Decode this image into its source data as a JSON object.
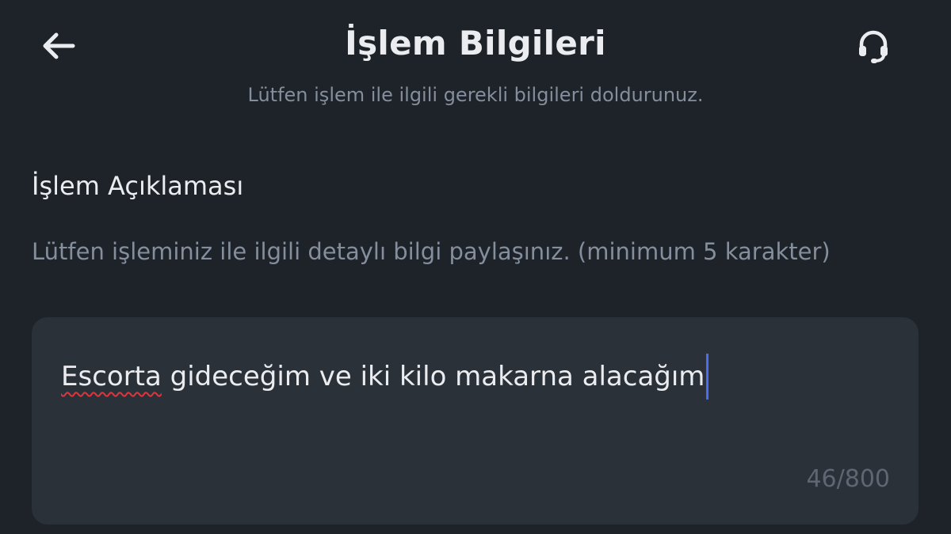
{
  "header": {
    "back_icon": "arrow-left-icon",
    "title": "İşlem Bilgileri",
    "subtitle": "Lütfen işlem ile ilgili gerekli bilgileri doldurunuz.",
    "support_icon": "headset-icon"
  },
  "description": {
    "label": "İşlem Açıklaması",
    "hint": "Lütfen işleminiz ile ilgili detaylı bilgi paylaşınız. (minimum 5 karakter)",
    "value_spellcheck_word": "Escorta",
    "value_rest": " gideceğim ve iki kilo makarna alacağım",
    "counter": "46/800"
  },
  "colors": {
    "background": "#1e2329",
    "field_background": "#2b3139",
    "primary_text": "#eaecef",
    "secondary_text": "#848e9c",
    "caret": "#4a6cf7",
    "spellcheck_underline": "#e0353b"
  }
}
